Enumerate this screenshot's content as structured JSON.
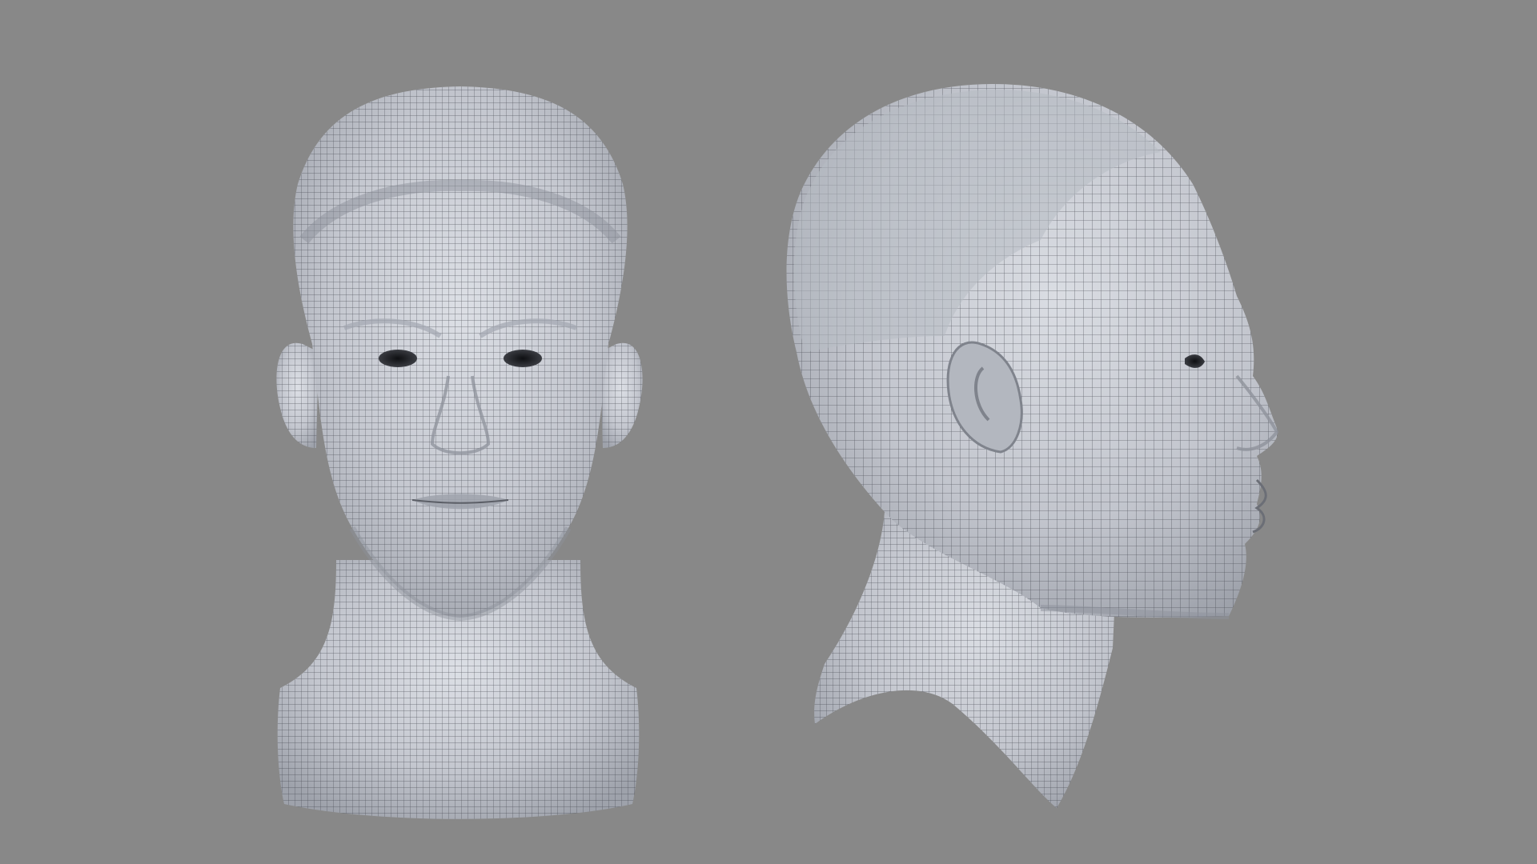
{
  "scene": {
    "background_color": "#888888",
    "model_color": "#c9ccd3",
    "wire_color": "#3d4048"
  },
  "models": [
    {
      "name": "head-front-view",
      "view": "front"
    },
    {
      "name": "head-side-view",
      "view": "side"
    }
  ]
}
